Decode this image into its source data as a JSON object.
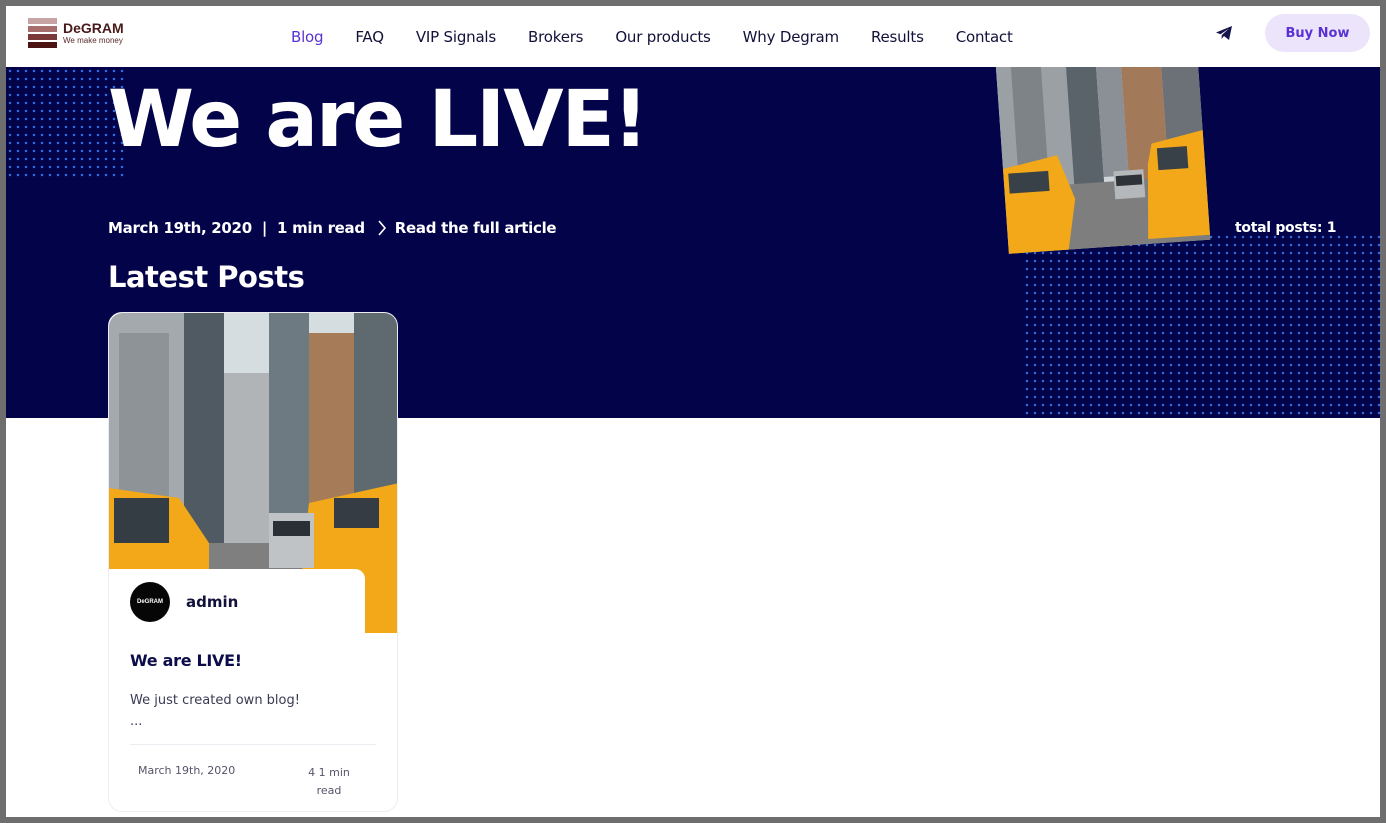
{
  "header": {
    "logo": {
      "brand": "DeGRAM",
      "tagline": "We make money"
    },
    "nav": [
      {
        "label": "Blog",
        "active": true
      },
      {
        "label": "FAQ"
      },
      {
        "label": "VIP Signals"
      },
      {
        "label": "Brokers"
      },
      {
        "label": "Our products"
      },
      {
        "label": "Why Degram"
      },
      {
        "label": "Results"
      },
      {
        "label": "Contact"
      }
    ],
    "telegram_icon": "telegram-icon",
    "buy_label": "Buy Now"
  },
  "hero": {
    "title": "We are LIVE!",
    "date": "March 19th, 2020",
    "separator": "|",
    "read_time": "1 min read",
    "read_link": "Read the full article",
    "total_posts": "total posts: 1",
    "section_title": "Latest Posts"
  },
  "posts": [
    {
      "author": "admin",
      "avatar_text": "DeGRAM",
      "title": "We are LIVE!",
      "excerpt": "We just created own blog!",
      "ellipsis": "...",
      "date": "March 19th, 2020",
      "read_time": "4 1 min read"
    }
  ],
  "colors": {
    "hero_bg": "#03034a",
    "accent": "#5a32d4",
    "button_bg": "#ebe4fa",
    "dots": "#2f6de0",
    "taxi_yellow": "#f2a818"
  }
}
